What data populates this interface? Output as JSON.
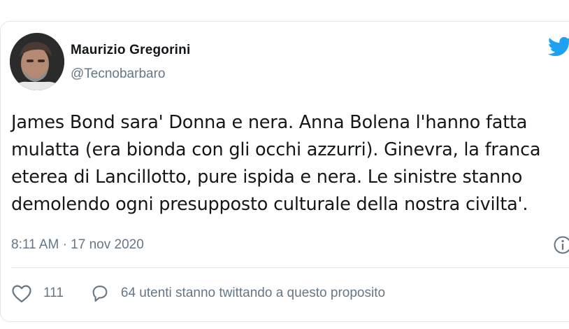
{
  "tweet": {
    "author_name": "Maurizio Gregorini",
    "author_handle": "@Tecnobarbaro",
    "text_lines": [
      "James Bond sara' Donna e nera. Anna Bolena l'hanno fatta",
      "mulatta (era bionda con gli occhi azzurri). Ginevra, la franca",
      "eterea di Lancillotto, pure ispida e nera. Le sinistre stanno",
      "demolendo ogni presupposto culturale della nostra civilta'."
    ],
    "timestamp": "8:11 AM · 17 nov 2020",
    "like_count": "111",
    "reply_label": "64 utenti stanno twittando a questo proposito"
  },
  "icons": {
    "brand": "twitter-bird-icon",
    "info": "info-icon",
    "like": "heart-icon",
    "reply": "speech-bubble-icon"
  },
  "colors": {
    "brand_blue": "#1da1f2",
    "text_primary": "#14171a",
    "text_secondary": "#657786",
    "border": "#e1e8ed"
  }
}
